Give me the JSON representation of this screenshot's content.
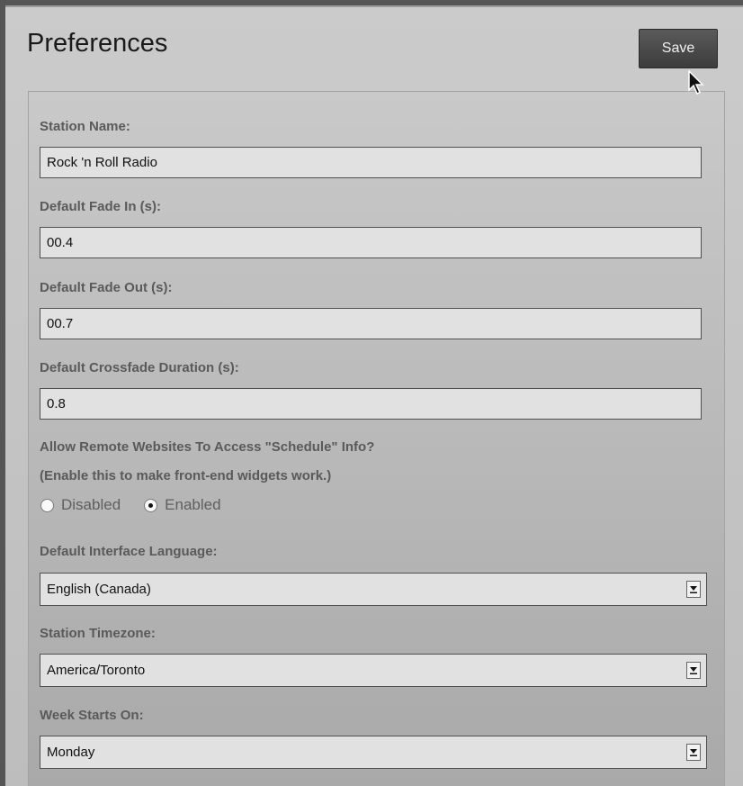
{
  "header": {
    "title": "Preferences",
    "save_label": "Save"
  },
  "form": {
    "station_name": {
      "label": "Station Name:",
      "value": "Rock 'n Roll Radio"
    },
    "fade_in": {
      "label": "Default Fade In (s):",
      "value": "00.4"
    },
    "fade_out": {
      "label": "Default Fade Out (s):",
      "value": "00.7"
    },
    "crossfade": {
      "label": "Default Crossfade Duration (s):",
      "value": "0.8"
    },
    "remote_access": {
      "label": "Allow Remote Websites To Access \"Schedule\" Info?",
      "hint": "(Enable this to make front-end widgets work.)",
      "options": [
        {
          "label": "Disabled",
          "checked": false
        },
        {
          "label": "Enabled",
          "checked": true
        }
      ]
    },
    "language": {
      "label": "Default Interface Language:",
      "selected": "English (Canada)"
    },
    "timezone": {
      "label": "Station Timezone:",
      "selected": "America/Toronto"
    },
    "week_start": {
      "label": "Week Starts On:",
      "selected": "Monday"
    }
  },
  "icons": {
    "cursor": "mouse-pointer-icon",
    "dropdown": "chevron-down-icon"
  }
}
